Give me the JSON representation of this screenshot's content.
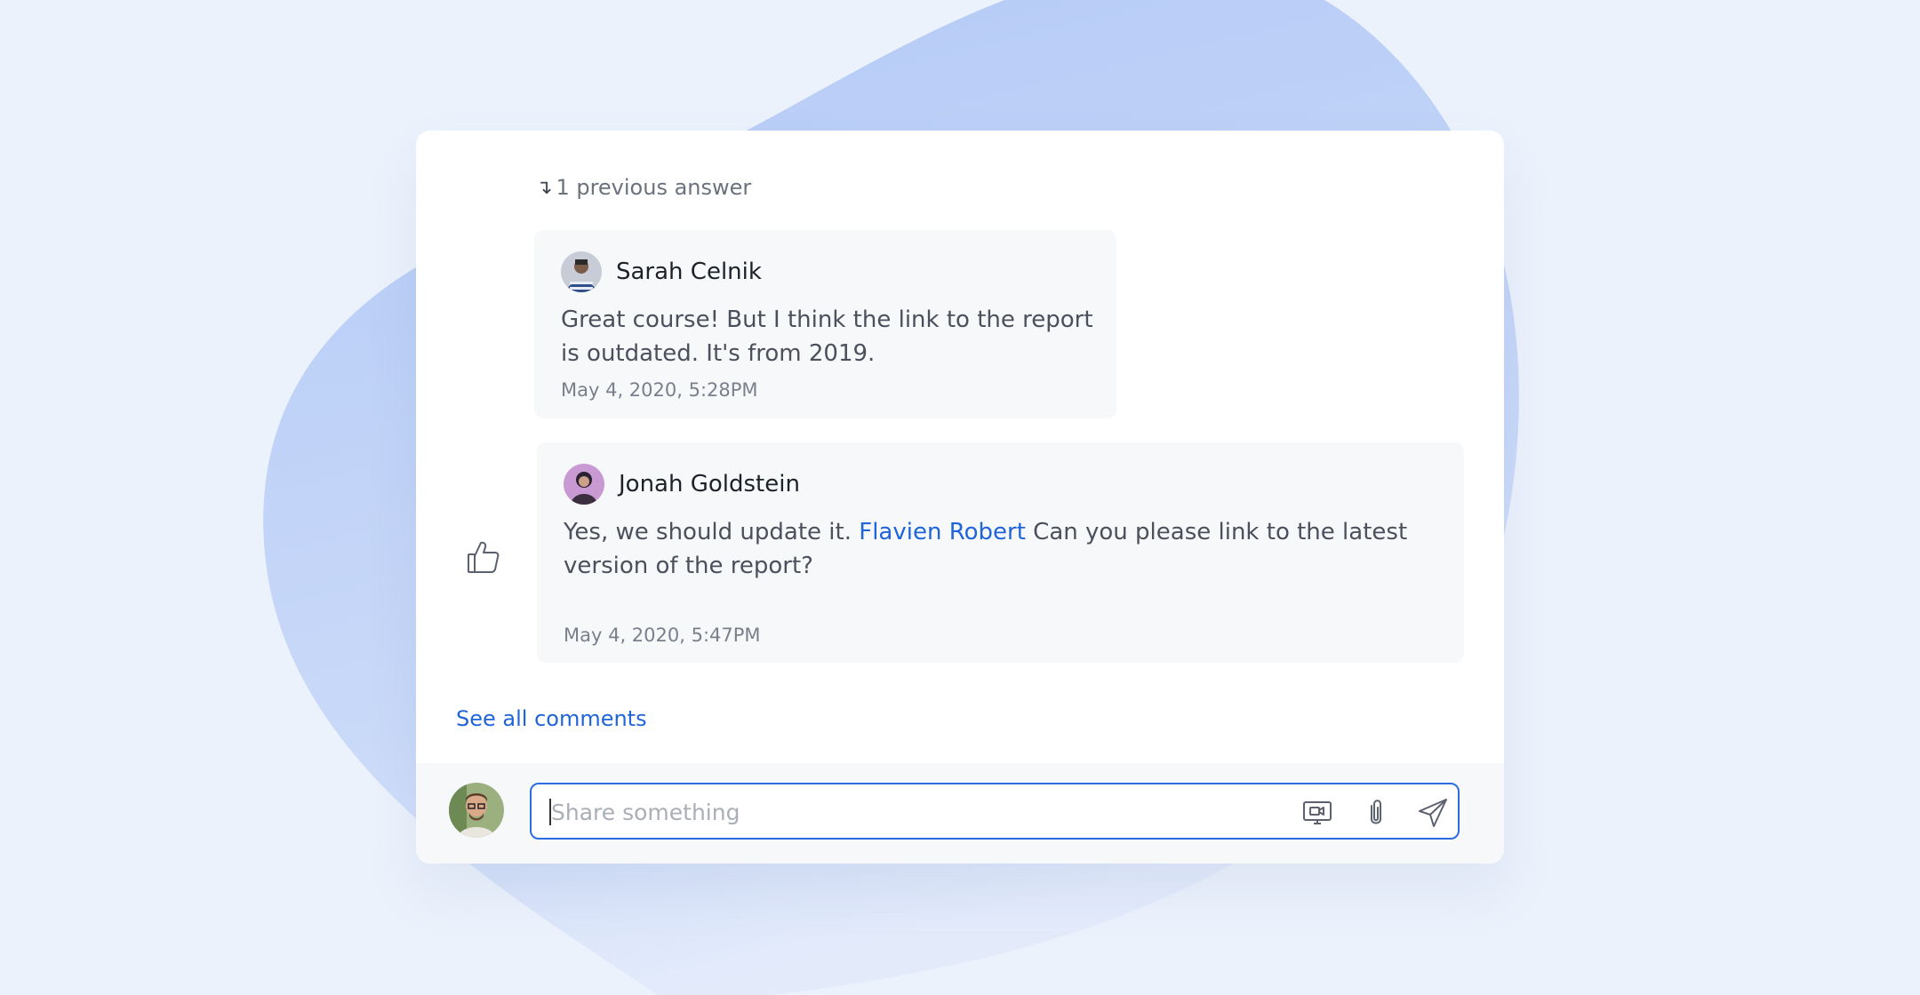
{
  "thread": {
    "previous_answers_label": "1 previous answer",
    "previous_answers_icon": "corner-down-right-arrow-icon"
  },
  "comments": [
    {
      "author": "Sarah Celnik",
      "text": "Great course! But I think the link to the report is outdated. It's from 2019.",
      "date": "May 4, 2020, 5:28PM"
    },
    {
      "author": "Jonah Goldstein",
      "text_before": "Yes, we should update it. ",
      "mention": "Flavien Robert",
      "text_after": " Can you please link to the latest version of the report?",
      "date": "May 4, 2020, 5:47PM"
    }
  ],
  "see_all_label": "See all comments",
  "composer": {
    "placeholder": "Share something",
    "value": "",
    "icons": [
      "screen-share-icon",
      "paperclip-icon",
      "send-icon"
    ]
  },
  "colors": {
    "background": "#ecf2fc",
    "blob": "#b9cdf7",
    "accent": "#1f64d8",
    "card": "#ffffff",
    "comment_bg": "#f7f8fa"
  }
}
